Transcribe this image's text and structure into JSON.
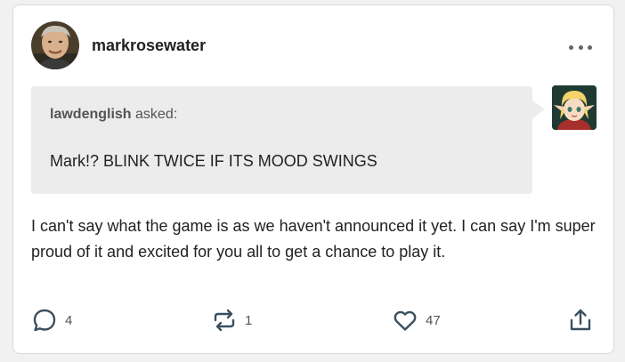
{
  "post": {
    "author": "markrosewater",
    "more_icon": "more-horizontal-icon",
    "ask": {
      "asker": "lawdenglish",
      "asked_label": " asked:",
      "question": "Mark!? BLINK TWICE IF ITS MOOD SWINGS"
    },
    "answer": "I can't say what the game is as we haven't announced it yet. I can say I'm super proud of it and excited for you all to get a chance to play it.",
    "actions": {
      "replies": {
        "icon": "comment-icon",
        "count": "4"
      },
      "reblogs": {
        "icon": "reblog-icon",
        "count": "1"
      },
      "likes": {
        "icon": "heart-icon",
        "count": "47"
      },
      "share": {
        "icon": "share-icon"
      }
    }
  },
  "colors": {
    "background": "#f1f1f1",
    "card": "#ffffff",
    "ask_box": "#ececec",
    "text": "#222222",
    "muted": "#555555",
    "icon": "#3a5060"
  }
}
